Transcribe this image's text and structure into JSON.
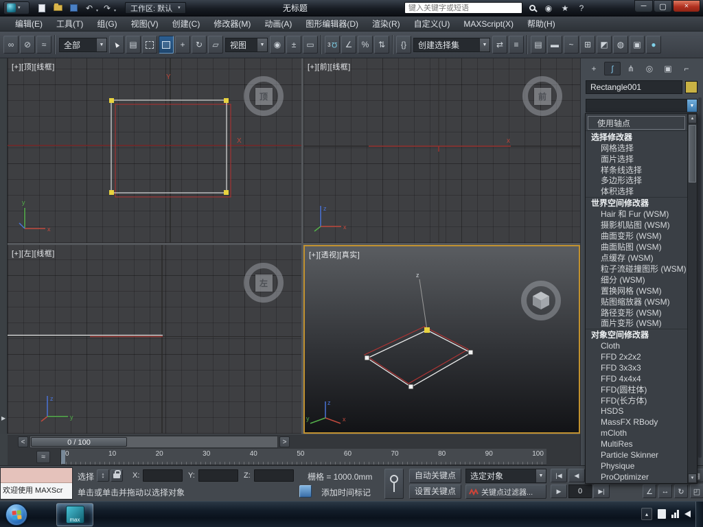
{
  "titlebar": {
    "workspace": "工作区: 默认",
    "doc_title": "无标题",
    "search_placeholder": "键入关键字或短语"
  },
  "menubar": {
    "items": [
      "编辑(E)",
      "工具(T)",
      "组(G)",
      "视图(V)",
      "创建(C)",
      "修改器(M)",
      "动画(A)",
      "图形编辑器(D)",
      "渲染(R)",
      "自定义(U)",
      "MAXScript(X)",
      "帮助(H)"
    ]
  },
  "toolbar": {
    "selection_filter": "全部",
    "ref_coord": "视图",
    "named_sets": "创建选择集"
  },
  "viewports": {
    "top": {
      "label": "[+][顶][线框]",
      "cube": "顶"
    },
    "front": {
      "label": "[+][前][线框]",
      "cube": "前"
    },
    "left": {
      "label": "[+][左][线框]",
      "cube": "左"
    },
    "persp": {
      "label": "[+][透视][真实]"
    }
  },
  "axes": {
    "x": "x",
    "y": "y",
    "z": "z",
    "xu": "X",
    "yu": "Y"
  },
  "panel": {
    "object_name": "Rectangle001",
    "modifiers": [
      {
        "label": "使用轴点",
        "type": "boxed"
      },
      {
        "label": "选择修改器",
        "type": "header"
      },
      {
        "label": "网格选择",
        "type": "item"
      },
      {
        "label": "面片选择",
        "type": "item"
      },
      {
        "label": "样条线选择",
        "type": "item"
      },
      {
        "label": "多边形选择",
        "type": "item"
      },
      {
        "label": "体积选择",
        "type": "item"
      },
      {
        "label": "世界空间修改器",
        "type": "header"
      },
      {
        "label": "Hair 和 Fur (WSM)",
        "type": "item"
      },
      {
        "label": "摄影机贴图 (WSM)",
        "type": "item"
      },
      {
        "label": "曲面变形 (WSM)",
        "type": "item"
      },
      {
        "label": "曲面贴图 (WSM)",
        "type": "item"
      },
      {
        "label": "点缓存 (WSM)",
        "type": "item"
      },
      {
        "label": "粒子流碰撞图形 (WSM)",
        "type": "item"
      },
      {
        "label": "细分 (WSM)",
        "type": "item"
      },
      {
        "label": "置换网格 (WSM)",
        "type": "item"
      },
      {
        "label": "贴图缩放器 (WSM)",
        "type": "item"
      },
      {
        "label": "路径变形 (WSM)",
        "type": "item"
      },
      {
        "label": "面片变形 (WSM)",
        "type": "item"
      },
      {
        "label": "对象空间修改器",
        "type": "header"
      },
      {
        "label": "Cloth",
        "type": "item"
      },
      {
        "label": "FFD 2x2x2",
        "type": "item"
      },
      {
        "label": "FFD 3x3x3",
        "type": "item"
      },
      {
        "label": "FFD 4x4x4",
        "type": "item"
      },
      {
        "label": "FFD(圆柱体)",
        "type": "item"
      },
      {
        "label": "FFD(长方体)",
        "type": "item"
      },
      {
        "label": "HSDS",
        "type": "item"
      },
      {
        "label": "MassFX RBody",
        "type": "item"
      },
      {
        "label": "mCloth",
        "type": "item"
      },
      {
        "label": "MultiRes",
        "type": "item"
      },
      {
        "label": "Particle Skinner",
        "type": "item"
      },
      {
        "label": "Physique",
        "type": "item"
      },
      {
        "label": "ProOptimizer",
        "type": "item"
      }
    ]
  },
  "timeline": {
    "prev": "<",
    "next": ">",
    "thumb": "0 / 100",
    "ticks": [
      "0",
      "10",
      "20",
      "30",
      "40",
      "50",
      "60",
      "70",
      "80",
      "90",
      "100"
    ]
  },
  "statusbar": {
    "welcome": "欢迎使用 MAXScr",
    "select": "选择",
    "x": "X:",
    "y": "Y:",
    "z": "Z:",
    "grid": "栅格 = 1000.0mm",
    "prompt": "单击或单击并拖动以选择对象",
    "time_tag": "添加时间标记",
    "auto_key": "自动关键点",
    "set_key": "设置关键点",
    "key_filter_target": "选定对象",
    "key_filters": "关键点过滤器...",
    "frame": "0"
  },
  "taskbar": {
    "app": "max"
  },
  "icons": {
    "caret": "▾",
    "dropdown": "▼",
    "undo": "↶",
    "redo": "↷",
    "user": "◉",
    "star": "★",
    "help": "?",
    "minimize": "─",
    "maximize": "▢",
    "close": "×",
    "link": "∞",
    "unlink": "⊘",
    "bind": "≈",
    "select": "▲",
    "select_by_name": "▤",
    "move": "+",
    "rotate": "↻",
    "scale": "▱",
    "center": "◉",
    "manipulate": "±",
    "keyboard": "▭",
    "snap_value": "3",
    "snap_magnet": "Ω",
    "angle_snap": "∠",
    "percent_snap": "%",
    "spinner_snap": "⇅",
    "named_sets": "{}",
    "mirror": "⇄",
    "align": "≡",
    "layers": "▤",
    "ribbon": "▬",
    "curve_editor": "~",
    "schematic": "⊞",
    "material": "◩",
    "render_setup": "◍",
    "render_frame": "▣",
    "render": "●",
    "tab_create": "+",
    "tab_modify": "ʃ",
    "tab_hierarchy": "⋔",
    "tab_motion": "◎",
    "tab_display": "▣",
    "tab_utilities": "⌐",
    "scroll_up": "▲",
    "scroll_down": "▼",
    "abs_mode": "↕",
    "go_start": "|◀",
    "prev_frame": "◀",
    "play": "▶",
    "next_frame": "▶|",
    "zoom": "⊕",
    "zoom_all": "⊞",
    "zoom_extents": "▣",
    "zoom_extents_all": "▦",
    "fov": "∠",
    "pan": "↔",
    "orbit": "↻",
    "max_viewport": "◰",
    "tray_up": "▴",
    "flyout": "▶",
    "mini_curve": "≈"
  }
}
